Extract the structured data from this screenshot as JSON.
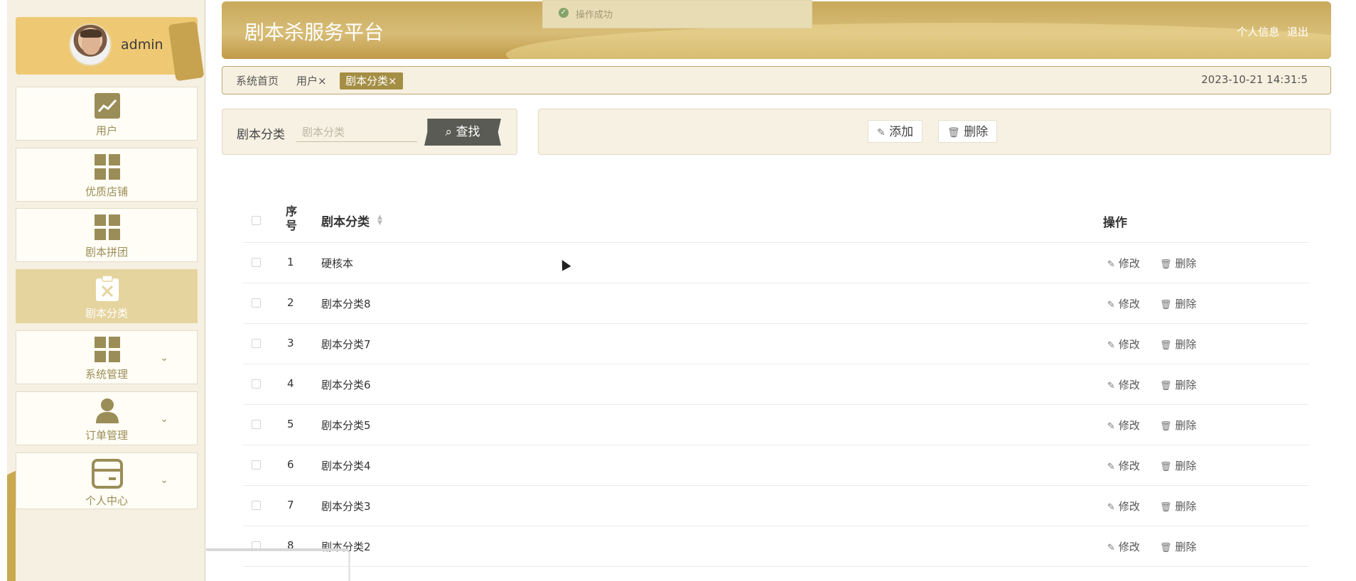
{
  "app": {
    "title": "剧本杀服务平台",
    "user": "admin",
    "header_links": [
      "个人信息",
      "退出"
    ]
  },
  "toast": {
    "message": "操作成功"
  },
  "sidebar": {
    "items": [
      {
        "label": "用户",
        "icon": "chart-icon",
        "active": false,
        "expandable": false
      },
      {
        "label": "优质店铺",
        "icon": "grid-icon",
        "active": false,
        "expandable": false
      },
      {
        "label": "剧本拼团",
        "icon": "grid-icon",
        "active": false,
        "expandable": false
      },
      {
        "label": "剧本分类",
        "icon": "clipboard-x-icon",
        "active": true,
        "expandable": false
      },
      {
        "label": "系统管理",
        "icon": "grid-icon",
        "active": false,
        "expandable": true
      },
      {
        "label": "订单管理",
        "icon": "person-icon",
        "active": false,
        "expandable": true
      },
      {
        "label": "个人中心",
        "icon": "card-icon",
        "active": false,
        "expandable": true
      }
    ]
  },
  "tabs": [
    {
      "label": "系统首页"
    },
    {
      "label": "用户×"
    },
    {
      "label": "剧本分类×"
    }
  ],
  "datetime": "2023-10-21 14:31:5",
  "search": {
    "label": "剧本分类",
    "placeholder": "剧本分类",
    "button": "查找"
  },
  "actions": {
    "add": "添加",
    "delete": "删除"
  },
  "table": {
    "headers": {
      "index": "序号",
      "name": "剧本分类",
      "ops": "操作"
    },
    "op_edit": "修改",
    "op_delete": "删除",
    "rows": [
      {
        "index": "1",
        "name": "硬核本"
      },
      {
        "index": "2",
        "name": "剧本分类8"
      },
      {
        "index": "3",
        "name": "剧本分类7"
      },
      {
        "index": "4",
        "name": "剧本分类6"
      },
      {
        "index": "5",
        "name": "剧本分类5"
      },
      {
        "index": "6",
        "name": "剧本分类4"
      },
      {
        "index": "7",
        "name": "剧本分类3"
      },
      {
        "index": "8",
        "name": "剧本分类2"
      }
    ]
  },
  "colors": {
    "accent": "#c9a95b",
    "active_menu": "#e5d49e",
    "active_tab": "#a48e44",
    "search_button": "#5b5b55"
  }
}
